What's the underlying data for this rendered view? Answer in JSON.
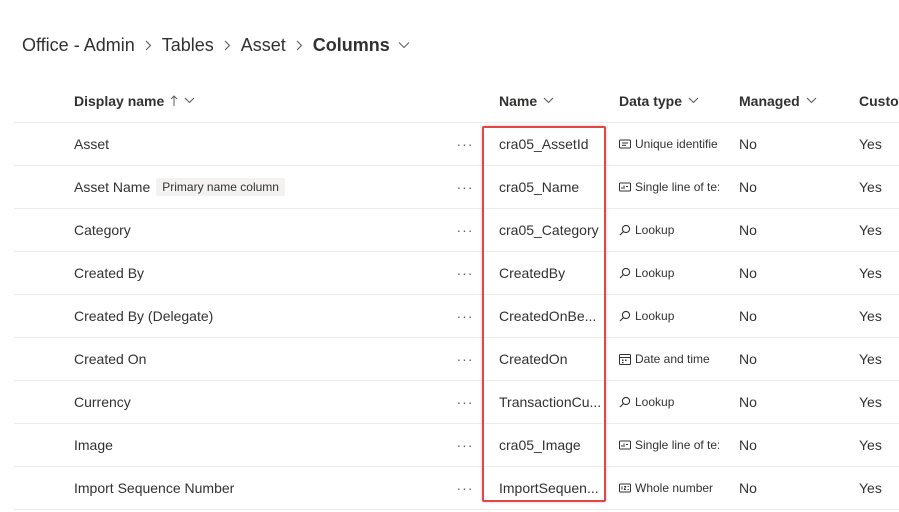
{
  "breadcrumb": {
    "items": [
      "Office - Admin",
      "Tables",
      "Asset"
    ],
    "current": "Columns"
  },
  "columns": {
    "display_name": "Display name",
    "sort_icon": "arrow-up-icon",
    "name": "Name",
    "data_type": "Data type",
    "managed": "Managed",
    "customizable": "Custor"
  },
  "rows": [
    {
      "display": "Asset",
      "badge": "",
      "name": "cra05_AssetId",
      "type_icon": "id-card-icon",
      "type": "Unique identifie",
      "managed": "No",
      "customizable": "Yes"
    },
    {
      "display": "Asset Name",
      "badge": "Primary name column",
      "name": "cra05_Name",
      "type_icon": "text-field-icon",
      "type": "Single line of te:",
      "managed": "No",
      "customizable": "Yes"
    },
    {
      "display": "Category",
      "badge": "",
      "name": "cra05_Category",
      "type_icon": "search-icon",
      "type": "Lookup",
      "managed": "No",
      "customizable": "Yes"
    },
    {
      "display": "Created By",
      "badge": "",
      "name": "CreatedBy",
      "type_icon": "search-icon",
      "type": "Lookup",
      "managed": "No",
      "customizable": "Yes"
    },
    {
      "display": "Created By (Delegate)",
      "badge": "",
      "name": "CreatedOnBe...",
      "type_icon": "search-icon",
      "type": "Lookup",
      "managed": "No",
      "customizable": "Yes"
    },
    {
      "display": "Created On",
      "badge": "",
      "name": "CreatedOn",
      "type_icon": "calendar-icon",
      "type": "Date and time",
      "managed": "No",
      "customizable": "Yes"
    },
    {
      "display": "Currency",
      "badge": "",
      "name": "TransactionCu...",
      "type_icon": "search-icon",
      "type": "Lookup",
      "managed": "No",
      "customizable": "Yes"
    },
    {
      "display": "Image",
      "badge": "",
      "name": "cra05_Image",
      "type_icon": "text-field-icon",
      "type": "Single line of te:",
      "managed": "No",
      "customizable": "Yes"
    },
    {
      "display": "Import Sequence Number",
      "badge": "",
      "name": "ImportSequen...",
      "type_icon": "number-icon",
      "type": "Whole number",
      "managed": "No",
      "customizable": "Yes"
    }
  ],
  "more_label": "···",
  "colors": {
    "highlight": "#e04848",
    "text": "#323130",
    "divider": "#edebe9"
  }
}
